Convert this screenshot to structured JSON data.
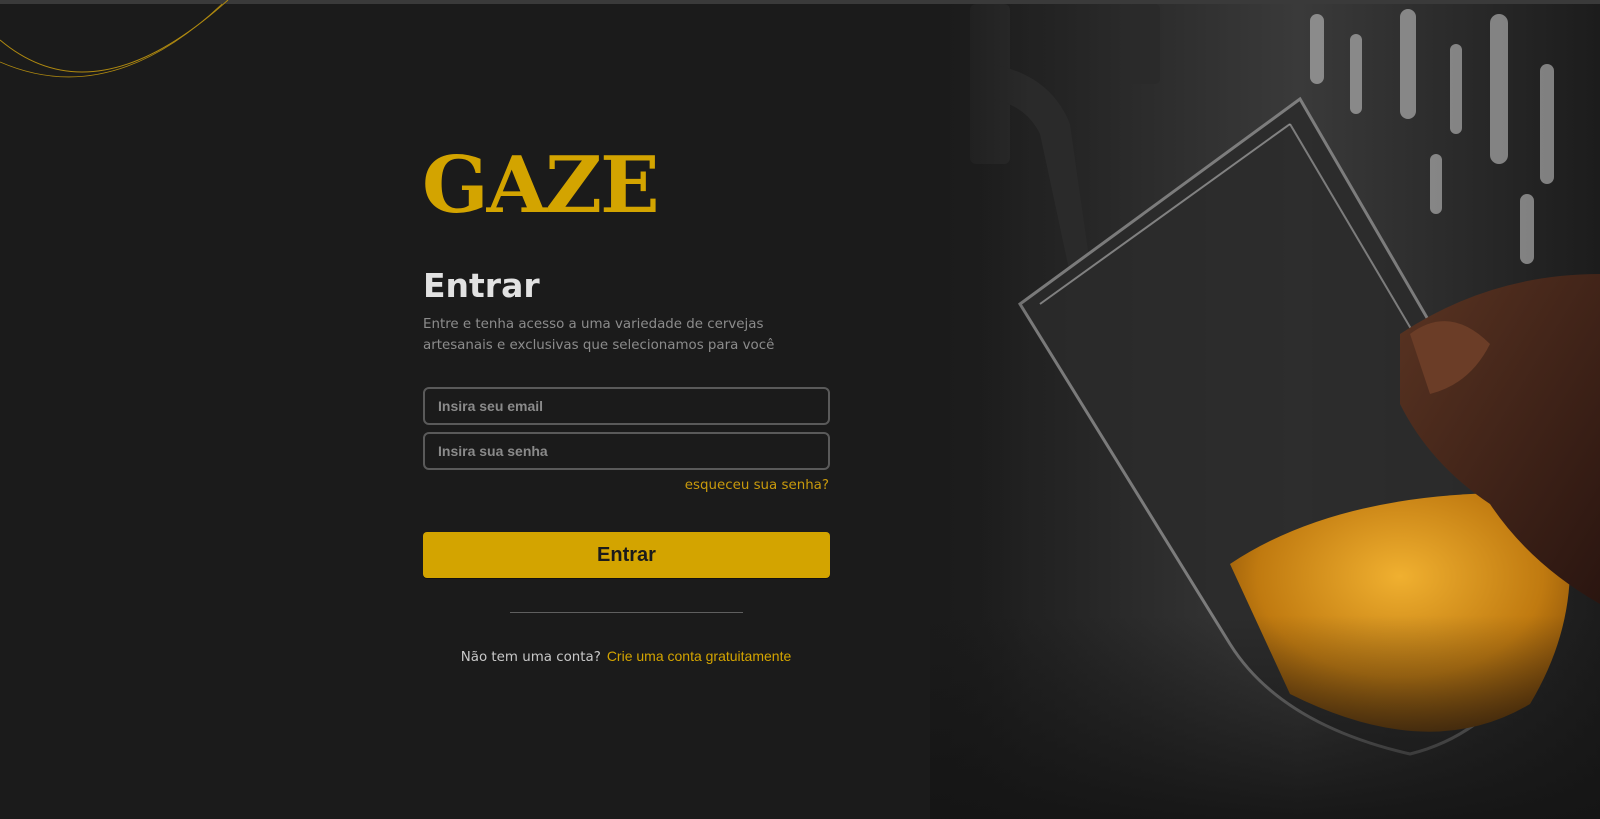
{
  "brand": {
    "logo_text": "GAZE",
    "accent_color": "#d3a400"
  },
  "login": {
    "title": "Entrar",
    "subtitle_line1": "Entre e tenha acesso a uma variedade de cervejas",
    "subtitle_line2": "artesanais e exclusivas que selecionamos para você",
    "email_placeholder": "Insira seu email",
    "password_placeholder": "Insira sua senha",
    "forgot_label": "esqueceu sua senha?",
    "submit_label": "Entrar",
    "no_account_text": "Não tem uma conta?",
    "signup_link": "Crie uma conta gratuitamente"
  },
  "hero_image": {
    "description_icon": "beer-tap-photo",
    "background": "#151515"
  }
}
